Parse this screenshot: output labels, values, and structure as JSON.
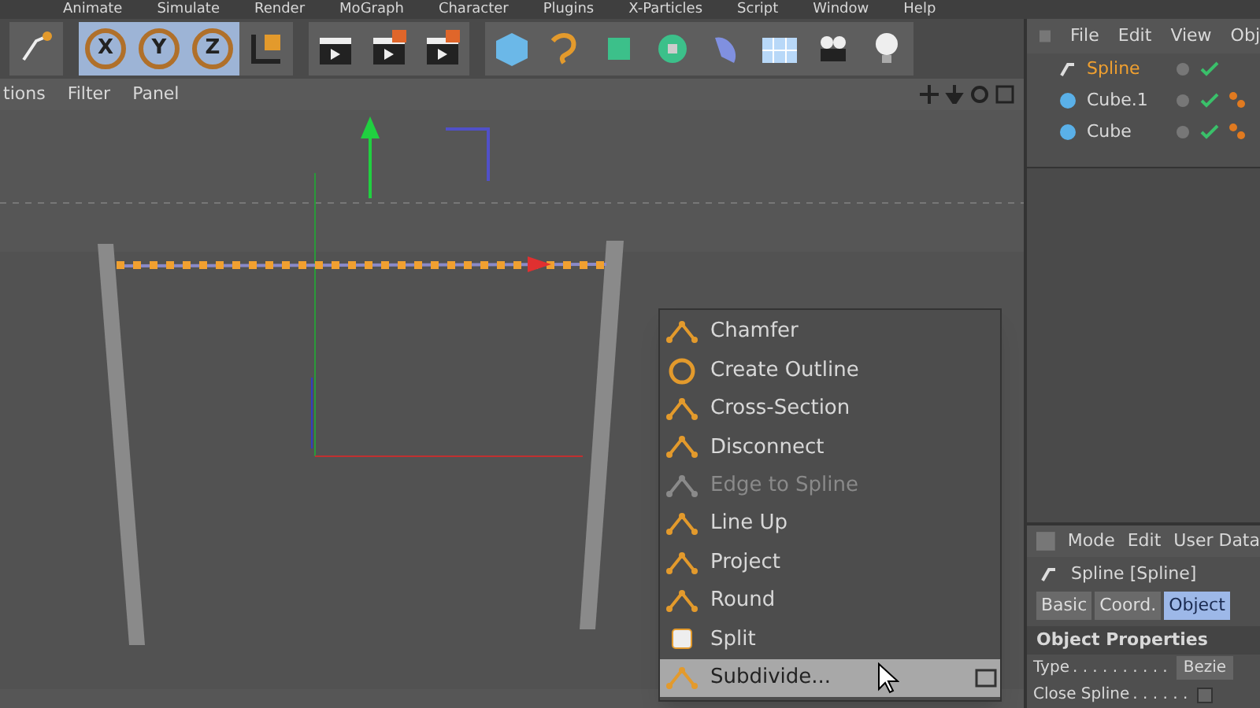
{
  "menu_bar": [
    "Animate",
    "Simulate",
    "Render",
    "MoGraph",
    "Character",
    "Plugins",
    "X-Particles",
    "Script",
    "Window",
    "Help"
  ],
  "toolbar": {
    "axis_buttons": [
      {
        "label": "X",
        "on": true
      },
      {
        "label": "Y",
        "on": true
      },
      {
        "label": "Z",
        "on": true
      }
    ]
  },
  "viewport": {
    "menu": [
      "tions",
      "Filter",
      "Panel"
    ]
  },
  "context_menu": {
    "items": [
      {
        "label": "Chamfer",
        "disabled": false,
        "selected": false
      },
      {
        "label": "Create Outline",
        "disabled": false,
        "selected": false
      },
      {
        "label": "Cross-Section",
        "disabled": false,
        "selected": false
      },
      {
        "label": "Disconnect",
        "disabled": false,
        "selected": false
      },
      {
        "label": "Edge to Spline",
        "disabled": true,
        "selected": false
      },
      {
        "label": "Line Up",
        "disabled": false,
        "selected": false
      },
      {
        "label": "Project",
        "disabled": false,
        "selected": false
      },
      {
        "label": "Round",
        "disabled": false,
        "selected": false
      },
      {
        "label": "Split",
        "disabled": false,
        "selected": false
      },
      {
        "label": "Subdivide...",
        "disabled": false,
        "selected": true
      }
    ]
  },
  "object_manager": {
    "menu": [
      "File",
      "Edit",
      "View",
      "Obj"
    ],
    "objects": [
      {
        "name": "Spline",
        "kind": "spline",
        "selected": true,
        "tag": false
      },
      {
        "name": "Cube.1",
        "kind": "cube",
        "selected": false,
        "tag": true
      },
      {
        "name": "Cube",
        "kind": "cube",
        "selected": false,
        "tag": true
      }
    ]
  },
  "attributes": {
    "menu": [
      "Mode",
      "Edit",
      "User Data"
    ],
    "title": "Spline [Spline]",
    "tabs": [
      {
        "label": "Basic",
        "selected": false
      },
      {
        "label": "Coord.",
        "selected": false
      },
      {
        "label": "Object",
        "selected": true
      }
    ],
    "section": "Object Properties",
    "fields": [
      {
        "label": "Type",
        "leader": ". . . . . . . . . .",
        "kind": "dropdown",
        "value": "Bezie"
      },
      {
        "label": "Close Spline",
        "leader": ". . . . . .",
        "kind": "checkbox",
        "checked": false
      }
    ]
  }
}
